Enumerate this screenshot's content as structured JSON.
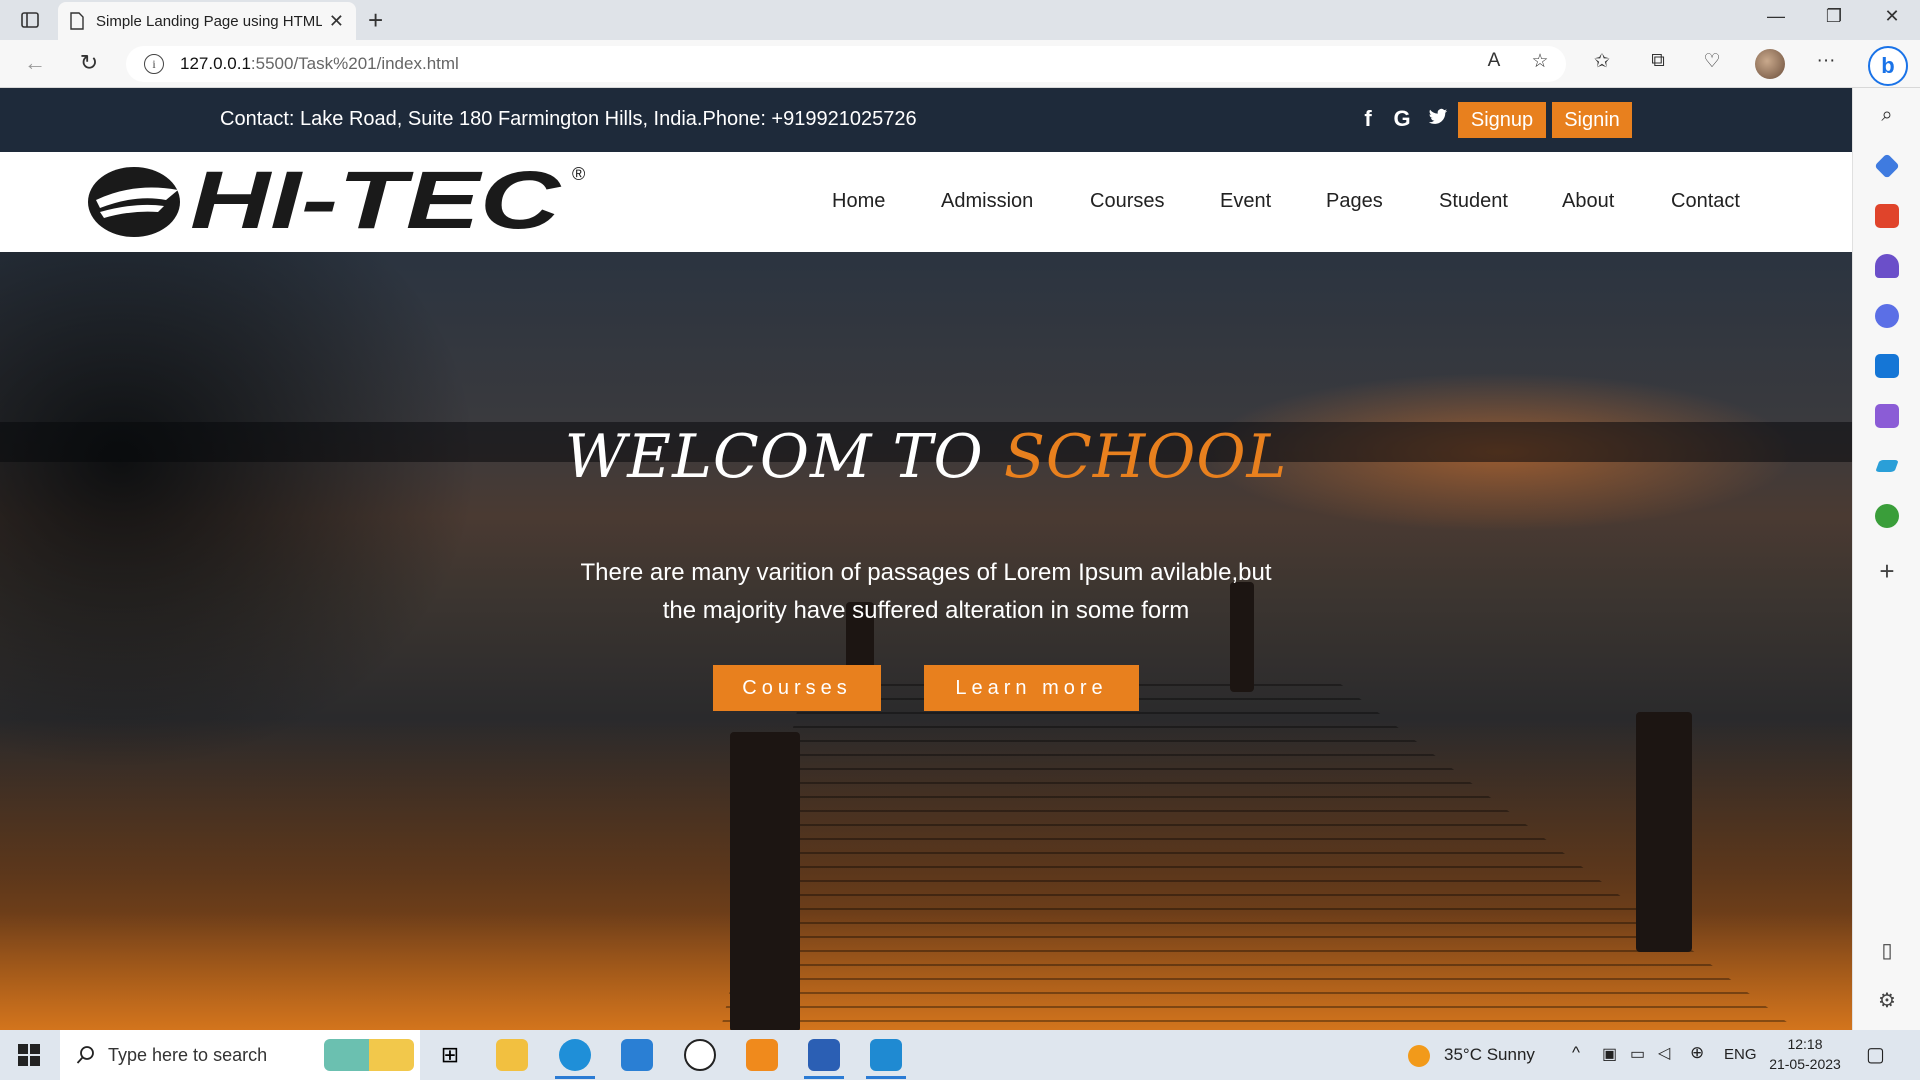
{
  "browser": {
    "tab_title": "Simple Landing Page using HTML",
    "tab_close": "✕",
    "new_tab": "+",
    "url_host": "127.0.0.1",
    "url_path": ":5500/Task%201/index.html",
    "window_controls": [
      "—",
      "❐",
      "✕"
    ],
    "toolbar_icons": [
      "read-aloud-icon",
      "add-favorite-icon",
      "favorites-icon",
      "collections-icon",
      "browser-essentials-icon",
      "profile-avatar",
      "more-icon",
      "bing-chat-icon"
    ],
    "more_label": "···",
    "bing_label": "b"
  },
  "sidebar": {
    "icons": [
      "search-icon",
      "shopping-icon",
      "tools-icon",
      "games-icon",
      "office-icon",
      "outlook-icon",
      "drop-icon",
      "telegram-icon",
      "tree-icon"
    ],
    "plus": "+"
  },
  "topbar": {
    "contact": "Contact: Lake Road, Suite 180 Farmington Hills, India.Phone: +919921025726",
    "social": [
      "f",
      "G",
      "t"
    ],
    "signup": "Signup",
    "signin": "Signin"
  },
  "navbar": {
    "logo_text": "HI-TEC",
    "logo_reg": "®",
    "links": [
      "Home",
      "Admission",
      "Courses",
      "Event",
      "Pages",
      "Student",
      "About",
      "Contact"
    ]
  },
  "hero": {
    "title_white": "WELCOM TO ",
    "title_orange": "SCHOOL",
    "subtitle_line1": "There are many varition of passages of Lorem Ipsum avilable,but",
    "subtitle_line2": "the majority have suffered alteration in some form",
    "btn_courses": "Courses",
    "btn_learn": "Learn more"
  },
  "colors": {
    "accent": "#e8801e",
    "topbar_bg": "#1e2a3a"
  },
  "taskbar": {
    "search_placeholder": "Type here to search",
    "weather": "35°C  Sunny",
    "language": "ENG",
    "time": "12:18",
    "date": "21-05-2023"
  }
}
